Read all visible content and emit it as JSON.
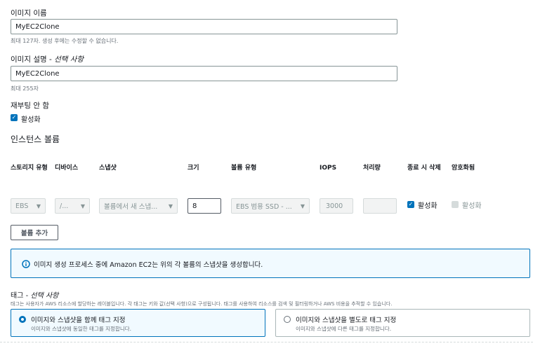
{
  "image_name": {
    "label": "이미지 이름",
    "value": "MyEC2Clone",
    "hint": "최대 127자. 생성 후에는 수정할 수 없습니다."
  },
  "image_description": {
    "label": "이미지 설명 - ",
    "optional": "선택 사항",
    "value": "MyEC2Clone",
    "hint": "최대 255자"
  },
  "no_reboot": {
    "label": "재부팅 안 함",
    "checkbox_label": "활성화",
    "checked": true
  },
  "instance_volumes": {
    "title": "인스턴스 볼륨",
    "columns": {
      "storage_type": "스토리지 유형",
      "device": "디바이스",
      "snapshot": "스냅샷",
      "size": "크기",
      "volume_type": "볼륨 유형",
      "iops": "IOPS",
      "throughput": "처리량",
      "delete_on_termination": "종료 시 삭제",
      "encrypted": "암호화됨"
    },
    "row": {
      "storage_type": "EBS",
      "device": "/...",
      "snapshot": "볼륨에서 새 스냅...",
      "size": "8",
      "volume_type": "EBS 범용 SSD - ...",
      "iops": "3000",
      "throughput": "",
      "delete_on_termination_label": "활성화",
      "delete_on_termination_checked": true,
      "encrypted_label": "활성화",
      "encrypted_checked": false
    },
    "add_volume_button": "볼륨 추가"
  },
  "info_alert": {
    "text": "이미지 생성 프로세스 중에 Amazon EC2는 위의 각 볼륨의 스냅샷을 생성합니다.",
    "icon": "info-icon"
  },
  "tags": {
    "label": "태그 - ",
    "optional": "선택 사항",
    "description": "태그는 사용자가 AWS 리소스에 할당하는 레이블입니다. 각 태그는 키와 값(선택 사항)으로 구성됩니다. 태그를 사용하여 리소스를 검색 및 필터링하거나 AWS 비용을 추적할 수 있습니다.",
    "options": [
      {
        "title": "이미지와 스냅샷을 함께 태그 지정",
        "desc": "이미지와 스냅샷에 동일한 태그를 지정합니다.",
        "selected": true
      },
      {
        "title": "이미지와 스냅샷을 별도로 태그 지정",
        "desc": "이미지와 스냅샷에 다른 태그를 지정합니다.",
        "selected": false
      }
    ]
  },
  "colors": {
    "accent": "#0073bb",
    "border": "#879596",
    "disabled_bg": "#f2f3f3",
    "info_bg": "#f1faff"
  }
}
